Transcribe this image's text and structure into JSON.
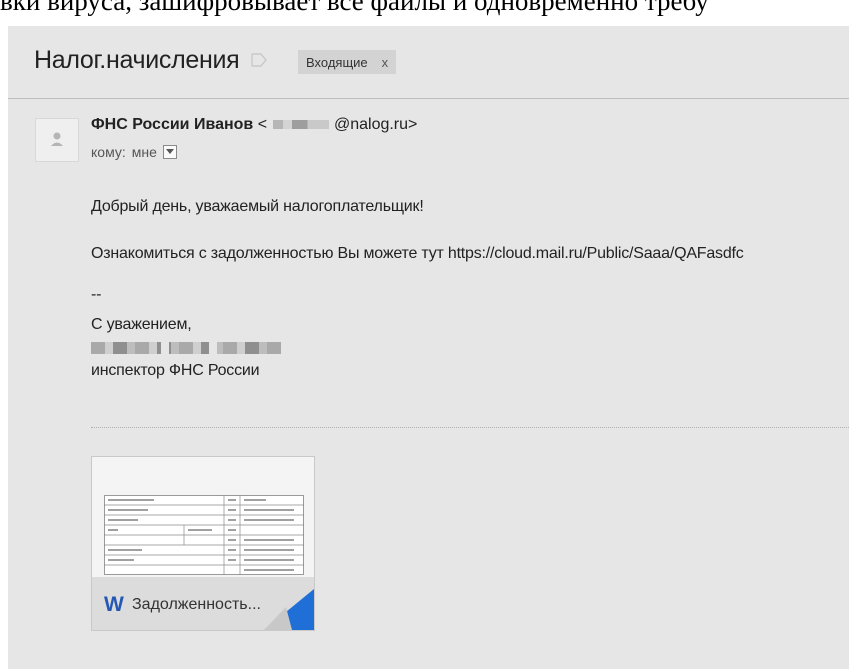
{
  "top_caption": "вки вируса, зашифровывает все файлы и одновременно требу",
  "email": {
    "subject": "Налог.начисления",
    "label": "Входящие",
    "label_close": "x",
    "sender_name": "ФНС России Иванов",
    "sender_open": "<",
    "sender_domain": "@nalog.ru>",
    "recipient_prefix": "кому:",
    "recipient": "мне",
    "body": {
      "greeting": "Добрый день, уважаемый налогоплательщик!",
      "message": "Ознакомиться с задолженностью Вы можете тут https://cloud.mail.ru/Public/Saaa/QAFasdfc",
      "sig_dashes": "--",
      "regards": "С уважением,",
      "signature_title": "инспектор ФНС России"
    },
    "attachment": {
      "icon": "word-document-icon",
      "name": "Задолженность..."
    }
  },
  "colors": {
    "background": "#e6e6e6",
    "label_chip": "#d3d3d3",
    "word_blue": "#2557b5",
    "corner_blue": "#1f6fd6"
  }
}
